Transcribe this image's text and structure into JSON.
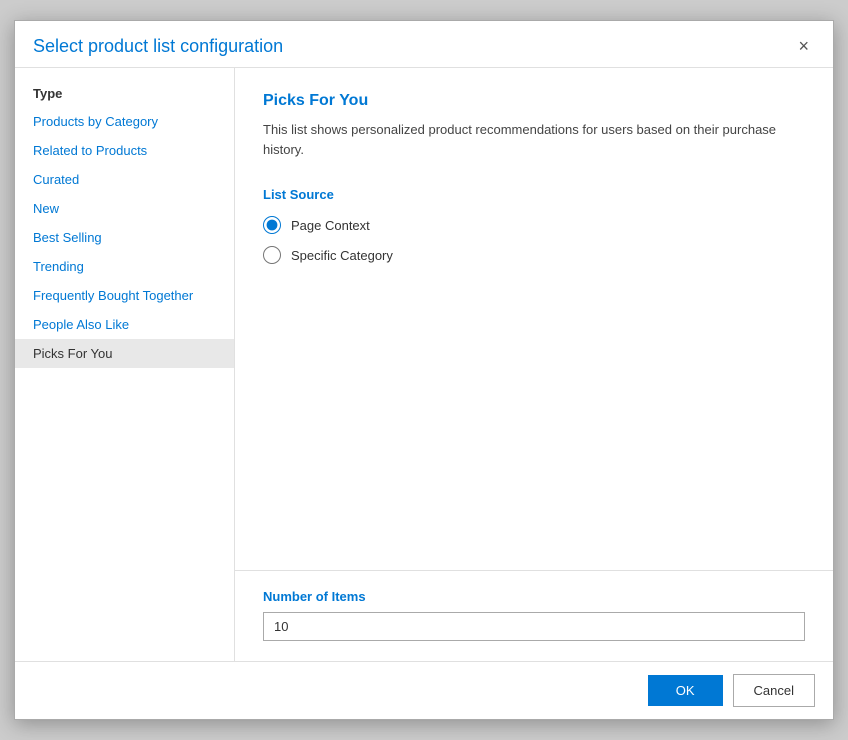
{
  "dialog": {
    "title": "Select product list configuration",
    "close_label": "×"
  },
  "sidebar": {
    "type_label": "Type",
    "items": [
      {
        "id": "products-by-category",
        "label": "Products by Category",
        "active": false
      },
      {
        "id": "related-to-products",
        "label": "Related to Products",
        "active": false
      },
      {
        "id": "curated",
        "label": "Curated",
        "active": false
      },
      {
        "id": "new",
        "label": "New",
        "active": false
      },
      {
        "id": "best-selling",
        "label": "Best Selling",
        "active": false
      },
      {
        "id": "trending",
        "label": "Trending",
        "active": false
      },
      {
        "id": "frequently-bought-together",
        "label": "Frequently Bought Together",
        "active": false
      },
      {
        "id": "people-also-like",
        "label": "People Also Like",
        "active": false
      },
      {
        "id": "picks-for-you",
        "label": "Picks For You",
        "active": true
      }
    ]
  },
  "content": {
    "title": "Picks For You",
    "description": "This list shows personalized product recommendations for users based on their purchase history.",
    "list_source_label": "List Source",
    "radio_options": [
      {
        "id": "page-context",
        "label": "Page Context",
        "checked": true
      },
      {
        "id": "specific-category",
        "label": "Specific Category",
        "checked": false
      }
    ]
  },
  "footer": {
    "number_of_items_label": "Number of Items",
    "number_value": "10",
    "ok_label": "OK",
    "cancel_label": "Cancel"
  }
}
